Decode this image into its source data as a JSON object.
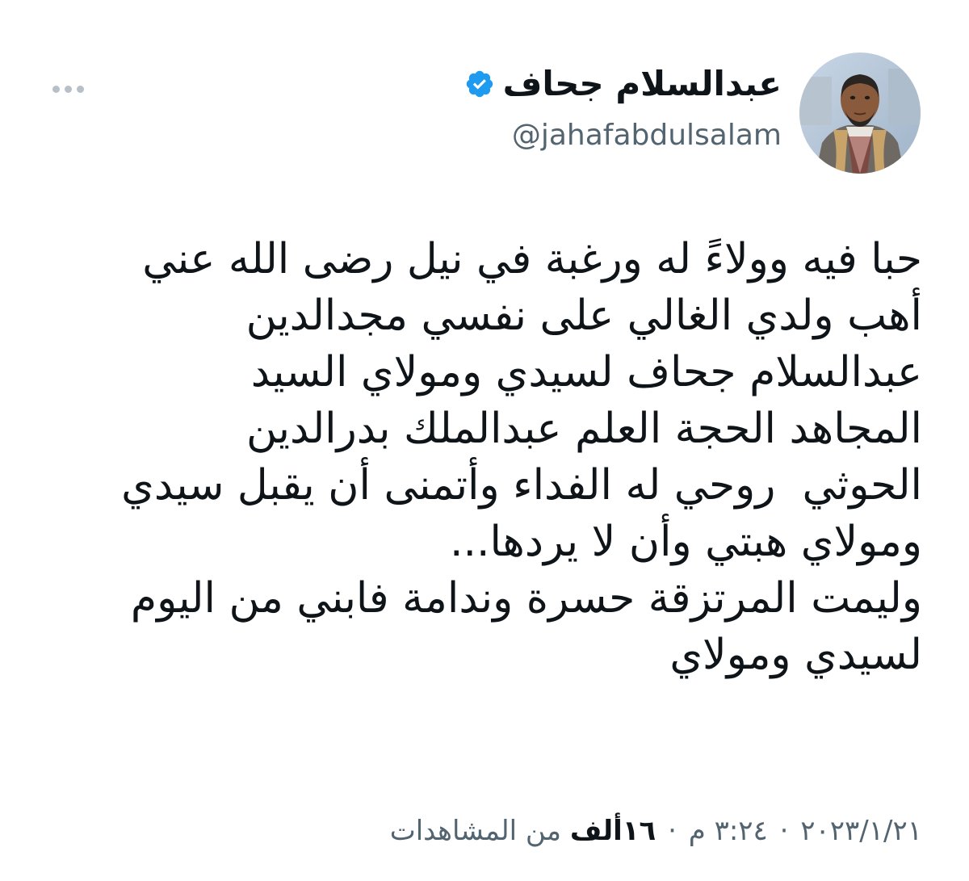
{
  "author": {
    "display_name": "عبدالسلام جحاف",
    "handle": "@jahafabdulsalam",
    "verified": true,
    "verified_color": "#1d9bf0"
  },
  "tweet": {
    "lines": [
      "حبا فيه وولاءً له ورغبة في نيل رضى الله عني",
      "أهب ولدي الغالي على نفسي مجدالدين",
      "عبدالسلام جحاف لسيدي ومولاي السيد",
      "المجاهد الحجة العلم عبدالملك بدرالدين",
      "الحوثي  روحي له الفداء وأتمنى أن يقبل سيدي",
      "ومولاي هبتي وأن لا يردها...",
      "وليمت المرتزقة حسرة وندامة فابني من اليوم",
      "لسيدي ومولاي"
    ]
  },
  "meta": {
    "date": "٢٠٢٣/١/٢١",
    "time": "٣:٢٤ م",
    "separator": "·",
    "views_count": "١٦ألف",
    "views_label": "من المشاهدات"
  },
  "icons": {
    "more": "more-horizontal-icon",
    "verified": "verified-badge-icon"
  },
  "colors": {
    "text_primary": "#0f1419",
    "text_secondary": "#536471",
    "more_dots": "#b8c0c7"
  }
}
